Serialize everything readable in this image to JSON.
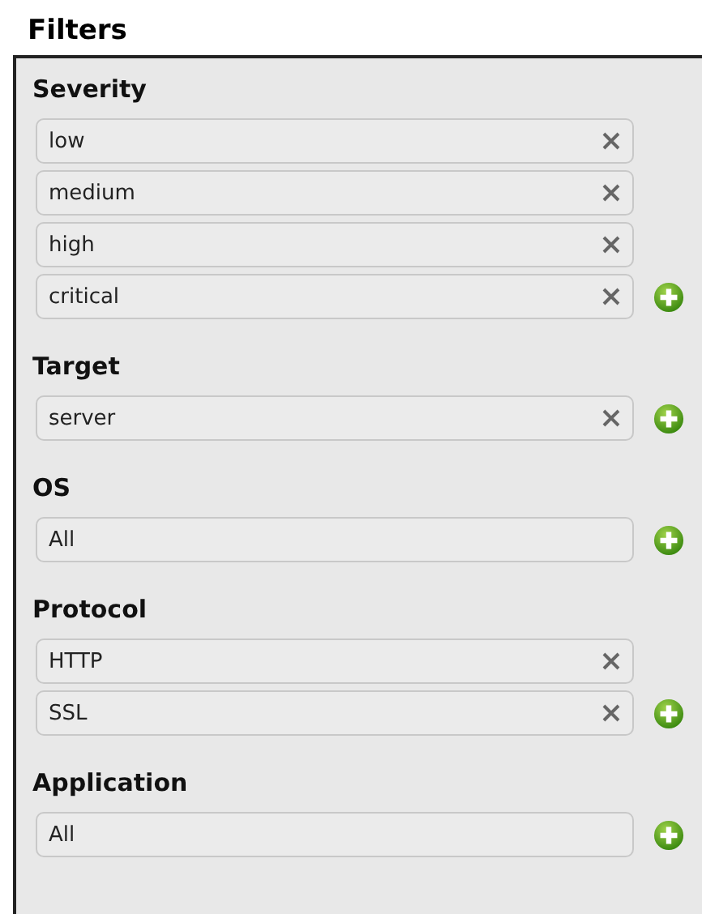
{
  "title": "Filters",
  "sections": [
    {
      "title": "Severity",
      "items": [
        {
          "value": "low",
          "removable": true
        },
        {
          "value": "medium",
          "removable": true
        },
        {
          "value": "high",
          "removable": true
        },
        {
          "value": "critical",
          "removable": true
        }
      ]
    },
    {
      "title": "Target",
      "items": [
        {
          "value": "server",
          "removable": true
        }
      ]
    },
    {
      "title": "OS",
      "items": [
        {
          "value": "All",
          "removable": false
        }
      ]
    },
    {
      "title": "Protocol",
      "items": [
        {
          "value": "HTTP",
          "removable": true
        },
        {
          "value": "SSL",
          "removable": true
        }
      ]
    },
    {
      "title": "Application",
      "items": [
        {
          "value": "All",
          "removable": false
        }
      ]
    }
  ]
}
